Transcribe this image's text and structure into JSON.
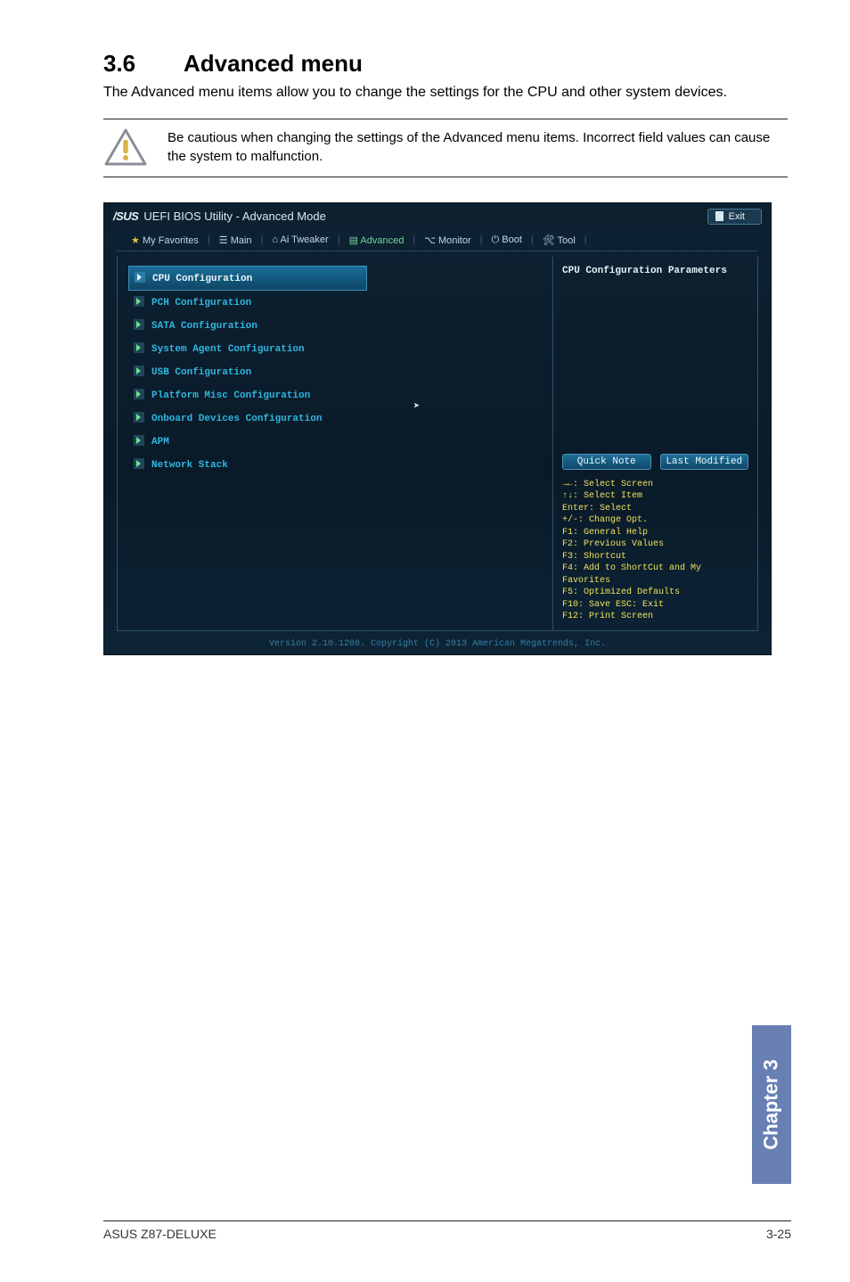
{
  "section": {
    "number": "3.6",
    "title": "Advanced menu"
  },
  "intro": "The Advanced menu items allow you to change the settings for the CPU and other system devices.",
  "caution": "Be cautious when changing the settings of the Advanced menu items. Incorrect field values can cause the system to malfunction.",
  "bios": {
    "brand": "/SUS",
    "window_title": "UEFI BIOS Utility - Advanced Mode",
    "exit_label": "Exit",
    "tabs": {
      "favorites": "My Favorites",
      "main": "Main",
      "ai_tweaker": "Ai Tweaker",
      "advanced": "Advanced",
      "monitor": "Monitor",
      "boot": "Boot",
      "tool": "Tool"
    },
    "menu": [
      "CPU Configuration",
      "PCH Configuration",
      "SATA Configuration",
      "System Agent Configuration",
      "USB Configuration",
      "Platform Misc Configuration",
      "Onboard Devices Configuration",
      "APM",
      "Network Stack"
    ],
    "right_title": "CPU Configuration Parameters",
    "quick_note": "Quick Note",
    "last_modified": "Last Modified",
    "help": [
      "→←: Select Screen",
      "↑↓: Select Item",
      "Enter: Select",
      "+/-: Change Opt.",
      "F1: General Help",
      "F2: Previous Values",
      "F3: Shortcut",
      "F4: Add to ShortCut and My Favorites",
      "F5: Optimized Defaults",
      "F10: Save  ESC: Exit",
      "F12: Print Screen"
    ],
    "footer": "Version 2.10.1208. Copyright (C) 2013 American Megatrends, Inc."
  },
  "chapter_tab": "Chapter 3",
  "footer": {
    "left": "ASUS Z87-DELUXE",
    "right": "3-25"
  }
}
